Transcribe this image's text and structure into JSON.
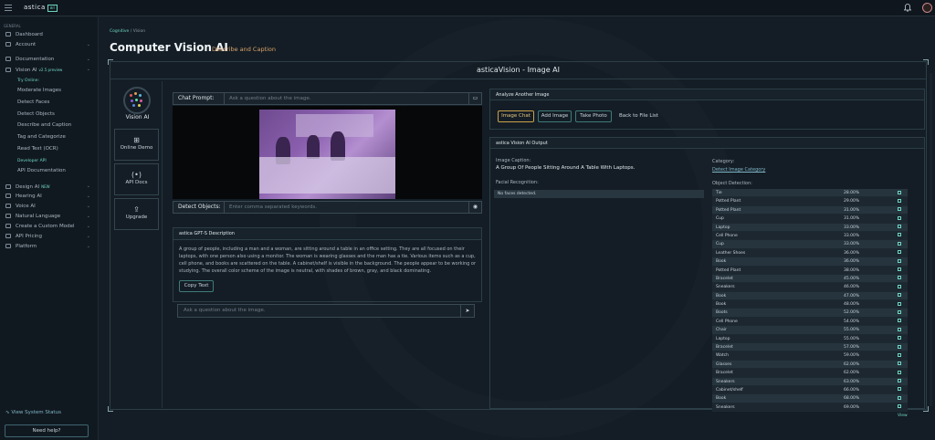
{
  "topbar": {
    "brand": "astica",
    "brand_box": "ai"
  },
  "sidebar": {
    "section": "GENERAL",
    "items": [
      {
        "label": "Dashboard",
        "chev": ""
      },
      {
        "label": "Account",
        "chev": "⌄"
      }
    ],
    "items2": [
      {
        "label": "Documentation",
        "chev": "⌄"
      },
      {
        "label": "Vision AI",
        "badge": "v2.5 preview",
        "chev": "⌄"
      }
    ],
    "try_label": "Try Online:",
    "try_items": [
      "Moderate Images",
      "Detect Faces",
      "Detect Objects",
      "Describe and Caption",
      "Tag and Categorize",
      "Read Text (OCR)"
    ],
    "dev_label": "Developer API",
    "dev_items": [
      "API Documentation"
    ],
    "items3": [
      {
        "label": "Design AI",
        "badge": "NEW",
        "chev": "⌄"
      },
      {
        "label": "Hearing AI",
        "chev": "⌄"
      },
      {
        "label": "Voice AI",
        "chev": "⌄"
      },
      {
        "label": "Natural Language",
        "chev": "⌄"
      },
      {
        "label": "Create a Custom Model",
        "chev": "⌄"
      },
      {
        "label": "API Pricing",
        "chev": "⌄"
      },
      {
        "label": "Platform",
        "chev": "⌄"
      }
    ],
    "system_status": "View System Status",
    "help": "Need help?"
  },
  "breadcrumb": {
    "first": "Cognitive",
    "sep": "/",
    "second": "Vision"
  },
  "page": {
    "title": "Computer Vision AI",
    "subtitle": "Describe and Caption"
  },
  "frame": {
    "title": "asticaVision - Image AI"
  },
  "left": {
    "vision_ai": "Vision AI",
    "online_demo": "Online Demo",
    "api_docs": "API Docs",
    "upgrade": "Upgrade",
    "online_glyph": "⊞",
    "api_glyph": "(•)",
    "upgrade_glyph": "⇪"
  },
  "prompt": {
    "label": "Chat Prompt:",
    "placeholder": "Ask a question about the image.",
    "icon": "▭"
  },
  "detect": {
    "label": "Detect Objects:",
    "placeholder": "Enter comma separated keywords.",
    "icon": "◉"
  },
  "gpt": {
    "title": "astica GPT-S Description",
    "text": "A group of people, including a man and a woman, are sitting around a table in an office setting. They are all focused on their laptops, with one person also using a monitor. The woman is wearing glasses and the man has a tie. Various items such as a cup, cell phone, and books are scattered on the table. A cabinet/shelf is visible in the background. The people appear to be working or studying. The overall color scheme of the image is neutral, with shades of brown, gray, and black dominating.",
    "copy": "Copy Text"
  },
  "ask": {
    "placeholder": "Ask a question about the image.",
    "icon": "➤"
  },
  "analyze": {
    "title": "Analyze Another Image",
    "buttons": [
      "Image Chat",
      "Add Image",
      "Take Photo"
    ],
    "back": "Back to File List"
  },
  "output": {
    "title": "astica Vision AI Output",
    "caption_label": "Image Caption:",
    "caption": "A Group Of People Sitting Around A Table With Laptops.",
    "facial_label": "Facial Recognition:",
    "facial": "No faces detected.",
    "category_label": "Category:",
    "category_link": "Detect Image Category",
    "objects_label": "Object Detection:",
    "view": "View",
    "objects": [
      {
        "name": "Tie",
        "pct": "28.00%"
      },
      {
        "name": "Potted Plant",
        "pct": "29.00%"
      },
      {
        "name": "Potted Plant",
        "pct": "31.00%"
      },
      {
        "name": "Cup",
        "pct": "31.00%"
      },
      {
        "name": "Laptop",
        "pct": "33.00%"
      },
      {
        "name": "Cell Phone",
        "pct": "33.00%"
      },
      {
        "name": "Cup",
        "pct": "33.00%"
      },
      {
        "name": "Leather Shoes",
        "pct": "36.00%"
      },
      {
        "name": "Book",
        "pct": "36.00%"
      },
      {
        "name": "Potted Plant",
        "pct": "38.00%"
      },
      {
        "name": "Bracelet",
        "pct": "45.00%"
      },
      {
        "name": "Sneakers",
        "pct": "46.00%"
      },
      {
        "name": "Book",
        "pct": "47.00%"
      },
      {
        "name": "Book",
        "pct": "48.00%"
      },
      {
        "name": "Boots",
        "pct": "52.00%"
      },
      {
        "name": "Cell Phone",
        "pct": "54.00%"
      },
      {
        "name": "Chair",
        "pct": "55.00%"
      },
      {
        "name": "Laptop",
        "pct": "55.00%"
      },
      {
        "name": "Bracelet",
        "pct": "57.00%"
      },
      {
        "name": "Watch",
        "pct": "59.00%"
      },
      {
        "name": "Glasses",
        "pct": "62.00%"
      },
      {
        "name": "Bracelet",
        "pct": "62.00%"
      },
      {
        "name": "Sneakers",
        "pct": "63.00%"
      },
      {
        "name": "Cabinet/shelf",
        "pct": "66.00%"
      },
      {
        "name": "Book",
        "pct": "68.00%"
      },
      {
        "name": "Sneakers",
        "pct": "69.00%"
      }
    ]
  },
  "colors": {
    "accent": "#6dd6c3",
    "highlight": "#c9a14a",
    "bg": "#141d25"
  }
}
